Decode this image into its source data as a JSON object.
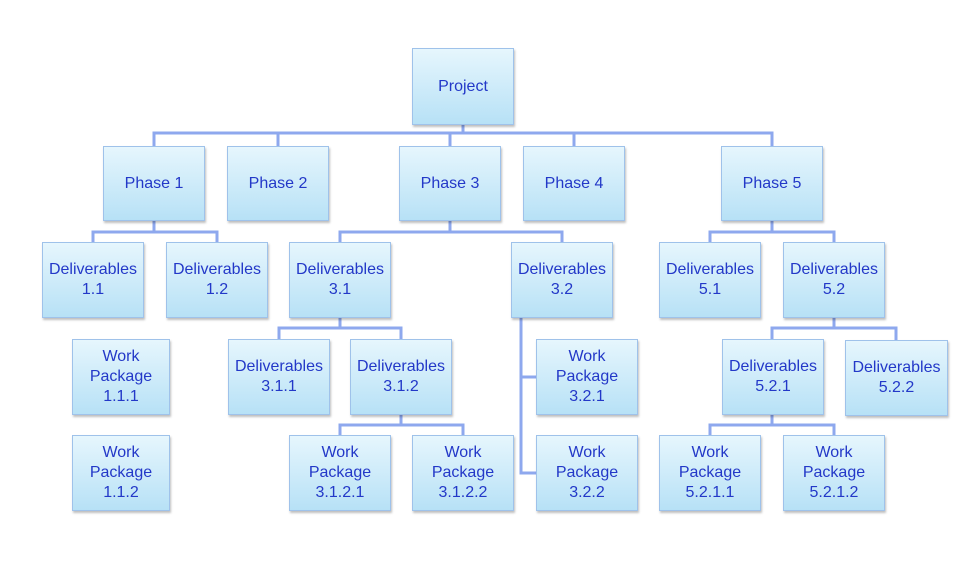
{
  "colors": {
    "box_top": "#e6f6fd",
    "box_bottom": "#b7e1f6",
    "text": "#2338c8",
    "connector": "#8ea8ee"
  },
  "nodes": {
    "project": "Project",
    "p1": "Phase 1",
    "p2": "Phase 2",
    "p3": "Phase 3",
    "p4": "Phase 4",
    "p5": "Phase 5",
    "d11": "Deliverables\n1.1",
    "d12": "Deliverables\n1.2",
    "d31": "Deliverables\n3.1",
    "d32": "Deliverables\n3.2",
    "d51": "Deliverables\n5.1",
    "d52": "Deliverables\n5.2",
    "wp111": "Work\nPackage\n1.1.1",
    "wp112": "Work\nPackage\n1.1.2",
    "d311": "Deliverables\n3.1.1",
    "d312": "Deliverables\n3.1.2",
    "wp3121": "Work\nPackage\n3.1.2.1",
    "wp3122": "Work\nPackage\n3.1.2.2",
    "wp321": "Work\nPackage\n3.2.1",
    "wp322": "Work\nPackage\n3.2.2",
    "d521": "Deliverables\n5.2.1",
    "d522": "Deliverables\n5.2.2",
    "wp5211": "Work\nPackage\n5.2.1.1",
    "wp5212": "Work\nPackage\n5.2.1.2"
  }
}
